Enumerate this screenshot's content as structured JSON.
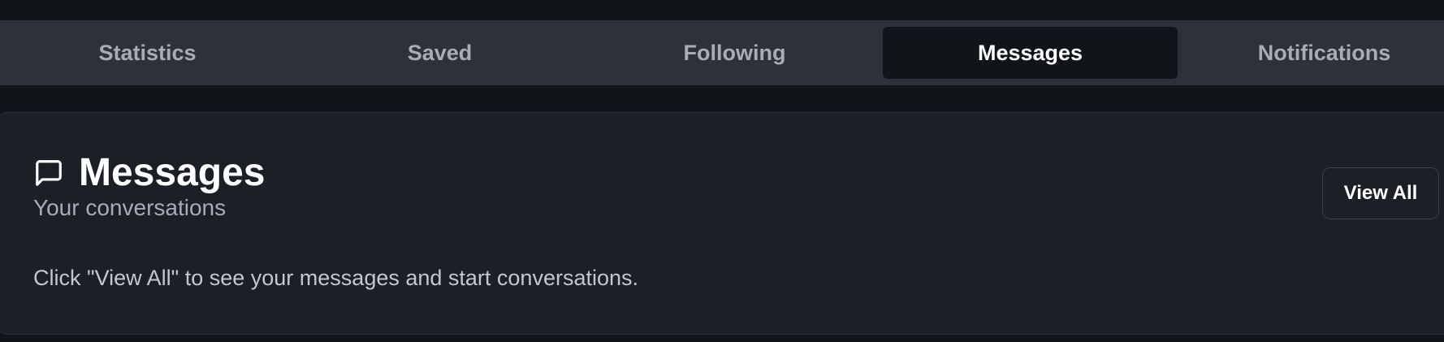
{
  "tabs": [
    {
      "label": "Statistics",
      "active": false
    },
    {
      "label": "Saved",
      "active": false
    },
    {
      "label": "Following",
      "active": false
    },
    {
      "label": "Messages",
      "active": true
    },
    {
      "label": "Notifications",
      "active": false
    }
  ],
  "card": {
    "icon": "message-square-icon",
    "title": "Messages",
    "subtitle": "Your conversations",
    "body": "Click \"View All\" to see your messages and start conversations.",
    "view_all_label": "View All"
  },
  "colors": {
    "page_background": "#111419",
    "tabbar_background": "#2d313b",
    "active_tab_background": "#111419",
    "card_background": "#1b1f26",
    "muted_text": "#a6acb8",
    "primary_text": "#ffffff"
  }
}
